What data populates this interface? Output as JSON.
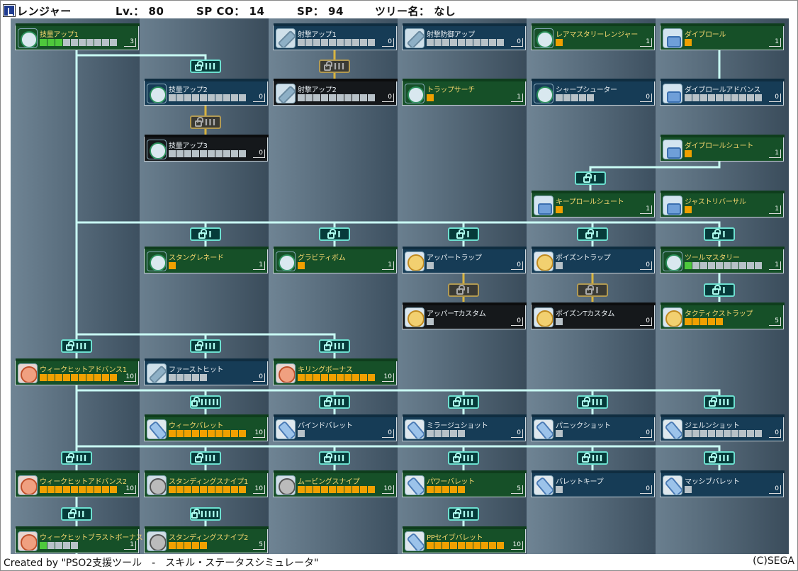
{
  "header": {
    "class_name": "レンジャー",
    "level": "Lv.： 80",
    "spco": "SP CO： 14",
    "sp": "SP： 94",
    "tree": "ツリー名： なし"
  },
  "footer": {
    "credit": "Created by \"PSO2支援ツール　-　スキル・ステータスシミュレータ\"",
    "copyright": "(C)SEGA"
  },
  "skills": [
    {
      "name": "技量アップ1",
      "level": "3",
      "icon": "target-icon",
      "color": "green"
    },
    {
      "name": "射撃アップ1",
      "level": "0",
      "icon": "rifle-icon",
      "color": "blue"
    },
    {
      "name": "射撃防御アップ",
      "level": "0",
      "icon": "rifle-icon",
      "color": "blue"
    },
    {
      "name": "レアマスタリーレンジャー",
      "level": "1",
      "icon": "star-icon",
      "color": "green"
    },
    {
      "name": "ダイブロール",
      "level": "1",
      "icon": "boot-icon",
      "color": "green"
    },
    {
      "name": "技量アップ2",
      "level": "0",
      "icon": "target-icon",
      "color": "blue"
    },
    {
      "name": "射撃アップ2",
      "level": "0",
      "icon": "rifle-icon",
      "color": "black"
    },
    {
      "name": "トラップサーチ",
      "level": "1",
      "icon": "search-icon",
      "color": "green"
    },
    {
      "name": "シャープシューター",
      "level": "0",
      "icon": "shooter-icon",
      "color": "blue"
    },
    {
      "name": "ダイブロールアドバンス",
      "level": "0",
      "icon": "boot-icon",
      "color": "blue"
    },
    {
      "name": "技量アップ3",
      "level": "0",
      "icon": "target-icon",
      "color": "black"
    },
    {
      "name": "ダイブロールシュート",
      "level": "1",
      "icon": "boot-icon",
      "color": "green"
    },
    {
      "name": "キープロールシュート",
      "level": "1",
      "icon": "boot-icon",
      "color": "green"
    },
    {
      "name": "ジャストリバーサル",
      "level": "1",
      "icon": "boot-icon",
      "color": "green"
    },
    {
      "name": "スタングレネード",
      "level": "1",
      "icon": "grenade-icon",
      "color": "green"
    },
    {
      "name": "グラビティボム",
      "level": "1",
      "icon": "bomb-icon",
      "color": "green"
    },
    {
      "name": "アッパートラップ",
      "level": "0",
      "icon": "trap-icon",
      "color": "blue"
    },
    {
      "name": "ポイズントラップ",
      "level": "0",
      "icon": "poison-trap-icon",
      "color": "blue"
    },
    {
      "name": "ツールマスタリー",
      "level": "1",
      "icon": "tool-icon",
      "color": "green"
    },
    {
      "name": "アッパーTカスタム",
      "level": "0",
      "icon": "trap-icon",
      "color": "black"
    },
    {
      "name": "ポイズンTカスタム",
      "level": "0",
      "icon": "poison-trap-icon",
      "color": "black"
    },
    {
      "name": "タクティクストラップ",
      "level": "5",
      "icon": "tactics-trap-icon",
      "color": "green"
    },
    {
      "name": "ウィークヒットアドバンス1",
      "level": "10",
      "icon": "weak-hit-icon",
      "color": "green"
    },
    {
      "name": "ファーストヒット",
      "level": "0",
      "icon": "rifle-icon",
      "color": "blue"
    },
    {
      "name": "キリングボーナス",
      "level": "10",
      "icon": "killing-icon",
      "color": "green"
    },
    {
      "name": "ウィークバレット",
      "level": "10",
      "icon": "weak-bullet-icon",
      "color": "green"
    },
    {
      "name": "バインドバレット",
      "level": "0",
      "icon": "bind-bullet-icon",
      "color": "blue"
    },
    {
      "name": "ミラージュショット",
      "level": "0",
      "icon": "mirage-icon",
      "color": "blue"
    },
    {
      "name": "パニックショット",
      "level": "0",
      "icon": "panic-icon",
      "color": "blue"
    },
    {
      "name": "ジェルンショット",
      "level": "0",
      "icon": "jellen-icon",
      "color": "blue"
    },
    {
      "name": "ウィークヒットアドバンス2",
      "level": "10",
      "icon": "weak-hit-icon",
      "color": "green"
    },
    {
      "name": "スタンディングスナイプ1",
      "level": "10",
      "icon": "snipe-icon",
      "color": "green"
    },
    {
      "name": "ムービングスナイプ",
      "level": "10",
      "icon": "snipe-icon",
      "color": "green"
    },
    {
      "name": "パワーバレット",
      "level": "5",
      "icon": "power-bullet-icon",
      "color": "green"
    },
    {
      "name": "バレットキープ",
      "level": "0",
      "icon": "bullet-keep-icon",
      "color": "blue"
    },
    {
      "name": "マッシブバレット",
      "level": "0",
      "icon": "massive-bullet-icon",
      "color": "blue"
    },
    {
      "name": "ウィークヒットブラストボーナス",
      "level": "1",
      "icon": "blast-icon",
      "color": "green"
    },
    {
      "name": "スタンディングスナイプ2",
      "level": "5",
      "icon": "snipe-icon",
      "color": "green"
    },
    {
      "name": "PPセイブバレット",
      "level": "10",
      "icon": "pp-save-icon",
      "color": "green"
    }
  ],
  "progress": [
    {
      "filled": 3,
      "total": 10,
      "fill": "g"
    },
    {
      "filled": 0,
      "total": 10,
      "fill": "o"
    },
    {
      "filled": 0,
      "total": 10,
      "fill": "o"
    },
    {
      "filled": 1,
      "total": 1,
      "fill": "o"
    },
    {
      "filled": 1,
      "total": 1,
      "fill": "o"
    },
    {
      "filled": 0,
      "total": 10,
      "fill": "o"
    },
    {
      "filled": 0,
      "total": 10,
      "fill": "o"
    },
    {
      "filled": 1,
      "total": 1,
      "fill": "o"
    },
    {
      "filled": 0,
      "total": 5,
      "fill": "o"
    },
    {
      "filled": 0,
      "total": 10,
      "fill": "o"
    },
    {
      "filled": 0,
      "total": 10,
      "fill": "o"
    },
    {
      "filled": 1,
      "total": 1,
      "fill": "o"
    },
    {
      "filled": 1,
      "total": 1,
      "fill": "o"
    },
    {
      "filled": 1,
      "total": 1,
      "fill": "o"
    },
    {
      "filled": 1,
      "total": 1,
      "fill": "o"
    },
    {
      "filled": 1,
      "total": 1,
      "fill": "o"
    },
    {
      "filled": 0,
      "total": 1,
      "fill": "o"
    },
    {
      "filled": 0,
      "total": 1,
      "fill": "o"
    },
    {
      "filled": 1,
      "total": 10,
      "fill": "g"
    },
    {
      "filled": 0,
      "total": 1,
      "fill": "o"
    },
    {
      "filled": 0,
      "total": 1,
      "fill": "o"
    },
    {
      "filled": 5,
      "total": 5,
      "fill": "o"
    },
    {
      "filled": 10,
      "total": 10,
      "fill": "o"
    },
    {
      "filled": 0,
      "total": 5,
      "fill": "o"
    },
    {
      "filled": 10,
      "total": 10,
      "fill": "o"
    },
    {
      "filled": 10,
      "total": 10,
      "fill": "o"
    },
    {
      "filled": 0,
      "total": 1,
      "fill": "o"
    },
    {
      "filled": 0,
      "total": 5,
      "fill": "o"
    },
    {
      "filled": 0,
      "total": 1,
      "fill": "o"
    },
    {
      "filled": 0,
      "total": 10,
      "fill": "o"
    },
    {
      "filled": 10,
      "total": 10,
      "fill": "o"
    },
    {
      "filled": 10,
      "total": 10,
      "fill": "o"
    },
    {
      "filled": 10,
      "total": 10,
      "fill": "o"
    },
    {
      "filled": 5,
      "total": 5,
      "fill": "o"
    },
    {
      "filled": 0,
      "total": 1,
      "fill": "o"
    },
    {
      "filled": 0,
      "total": 1,
      "fill": "o"
    },
    {
      "filled": 1,
      "total": 5,
      "fill": "g"
    },
    {
      "filled": 5,
      "total": 5,
      "fill": "o"
    },
    {
      "filled": 10,
      "total": 10,
      "fill": "o"
    }
  ],
  "locks": [
    {
      "label": "III",
      "state": "open"
    },
    {
      "label": "III",
      "state": "locked"
    },
    {
      "label": "III",
      "state": "locked"
    },
    {
      "label": "I",
      "state": "open"
    },
    {
      "label": "I",
      "state": "open"
    },
    {
      "label": "I",
      "state": "open"
    },
    {
      "label": "I",
      "state": "open"
    },
    {
      "label": "I",
      "state": "open"
    },
    {
      "label": "I",
      "state": "open"
    },
    {
      "label": "I",
      "state": "locked"
    },
    {
      "label": "I",
      "state": "locked"
    },
    {
      "label": "I",
      "state": "open"
    },
    {
      "label": "III",
      "state": "open"
    },
    {
      "label": "III",
      "state": "open"
    },
    {
      "label": "III",
      "state": "open"
    },
    {
      "label": "IIIII",
      "state": "open"
    },
    {
      "label": "III",
      "state": "open"
    },
    {
      "label": "III",
      "state": "open"
    },
    {
      "label": "III",
      "state": "open"
    },
    {
      "label": "III",
      "state": "open"
    },
    {
      "label": "III",
      "state": "open"
    },
    {
      "label": "III",
      "state": "open"
    },
    {
      "label": "III",
      "state": "open"
    },
    {
      "label": "III",
      "state": "open"
    },
    {
      "label": "III",
      "state": "open"
    },
    {
      "label": "III",
      "state": "open"
    },
    {
      "label": "II",
      "state": "open"
    },
    {
      "label": "IIIII",
      "state": "open"
    },
    {
      "label": "III",
      "state": "open"
    }
  ]
}
